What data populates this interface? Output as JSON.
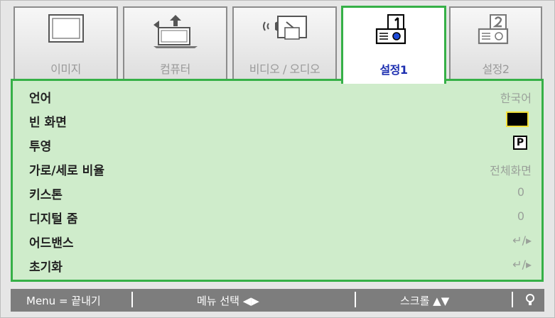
{
  "tabs": [
    {
      "label": "이미지",
      "icon": "monitor-icon"
    },
    {
      "label": "컴퓨터",
      "icon": "laptop-icon"
    },
    {
      "label": "비디오 / 오디오",
      "icon": "video-audio-icon"
    },
    {
      "label": "설정1",
      "icon": "settings1-projector-icon",
      "active": true
    },
    {
      "label": "설정2",
      "icon": "settings2-projector-icon"
    }
  ],
  "rows": [
    {
      "name": "언어",
      "value": "한국어"
    },
    {
      "name": "빈 화면",
      "value_icon": "black-screen-icon"
    },
    {
      "name": "투영",
      "value_glyph": "P"
    },
    {
      "name": "가로/세로 비율",
      "value": "전체화면"
    },
    {
      "name": "키스톤",
      "value": "0"
    },
    {
      "name": "디지털 줌",
      "value": "0"
    },
    {
      "name": "어드밴스",
      "value": "↵/▸"
    },
    {
      "name": "초기화",
      "value": "↵/▸"
    }
  ],
  "statusbar": {
    "menu_exit": "Menu = 끝내기",
    "menu_select": "메뉴 선택 ◀▶",
    "scroll": "스크롤 ▲▼",
    "bulb_icon": "lightbulb-icon"
  },
  "colors": {
    "accent": "#36b047",
    "panel_bg": "#cfeccb",
    "active_tab_text": "#1d2fb0",
    "statusbar_bg": "#7d7d7d"
  }
}
